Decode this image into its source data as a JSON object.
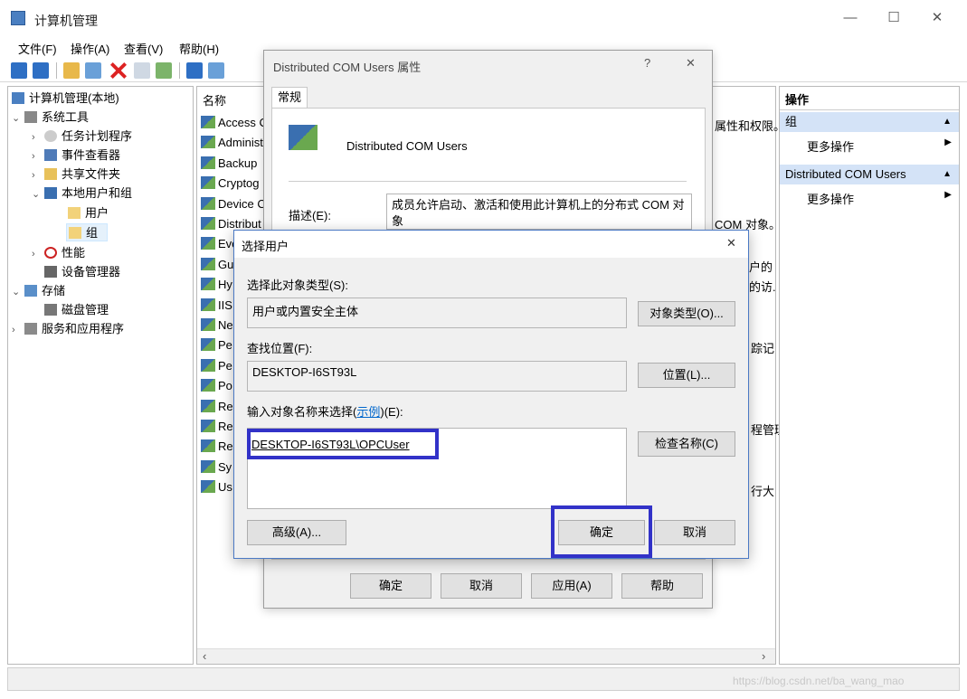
{
  "window": {
    "title": "计算机管理",
    "minimize": "—",
    "maximize": "☐",
    "close": "✕"
  },
  "menu": [
    "文件(F)",
    "操作(A)",
    "查看(V)",
    "帮助(H)"
  ],
  "tree": {
    "root": "计算机管理(本地)",
    "system_tools": "系统工具",
    "task_scheduler": "任务计划程序",
    "event_viewer": "事件查看器",
    "shared_folders": "共享文件夹",
    "local_users_groups": "本地用户和组",
    "users": "用户",
    "groups": "组",
    "performance": "性能",
    "device_manager": "设备管理器",
    "storage": "存储",
    "disk_management": "磁盘管理",
    "services_apps": "服务和应用程序"
  },
  "list": {
    "col_name": "名称",
    "rows": [
      "Access C",
      "Administ",
      "Backup",
      "Cryptog",
      "Device C",
      "Distribut",
      "Eve",
      "Gu",
      "Hy",
      "IIS",
      "Ne",
      "Pe",
      "Pe",
      "Po",
      "Re",
      "Re",
      "Re",
      "Sy",
      "Us"
    ],
    "desc_frags": [
      "属性和权限。",
      "COM 对象。",
      "户的",
      "的访.",
      "踪记",
      "程管理",
      "行大"
    ]
  },
  "actions": {
    "title": "操作",
    "group1": "组",
    "more1": "更多操作",
    "group2": "Distributed COM Users",
    "more2": "更多操作"
  },
  "props_dialog": {
    "title": "Distributed COM Users 属性",
    "help": "?",
    "close": "✕",
    "tab": "常规",
    "group_name": "Distributed COM Users",
    "desc_label": "描述(E):",
    "desc_value": "成员允许启动、激活和使用此计算机上的分布式 COM 对象",
    "ok": "确定",
    "cancel": "取消",
    "apply": "应用(A)",
    "help_btn": "帮助"
  },
  "select_dialog": {
    "title": "选择用户",
    "close": "✕",
    "object_type_label": "选择此对象类型(S):",
    "object_type_value": "用户或内置安全主体",
    "object_type_btn": "对象类型(O)...",
    "location_label": "查找位置(F):",
    "location_value": "DESKTOP-I6ST93L",
    "location_btn": "位置(L)...",
    "enter_label_pre": "输入对象名称来选择(",
    "enter_label_link": "示例",
    "enter_label_post": ")(E):",
    "enter_value": "DESKTOP-I6ST93L\\OPCUser",
    "check_btn": "检查名称(C)",
    "advanced_btn": "高级(A)...",
    "ok": "确定",
    "cancel": "取消"
  },
  "watermark": "https://blog.csdn.net/ba_wang_mao"
}
